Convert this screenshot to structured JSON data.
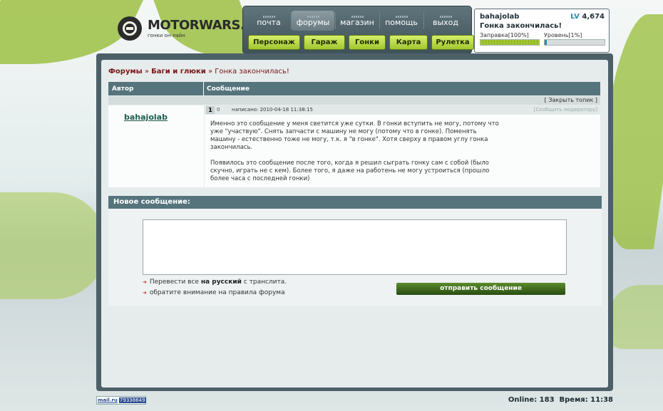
{
  "logo": {
    "title": "MOTORWARS.RU",
    "subtitle": "гонки он-лайн"
  },
  "nav": {
    "top": [
      "почта",
      "форумы",
      "магазин",
      "помощь",
      "выход"
    ],
    "active_tab": "форумы",
    "bottom": [
      "Персонаж",
      "Гараж",
      "Гонки",
      "Карта",
      "Рулетка"
    ]
  },
  "user": {
    "name": "bahajolab",
    "level_prefix": "LV",
    "level": "4,674",
    "status": "Гонка закончилась!",
    "fuel_label": "Заправка[100%]",
    "fuel_value": 1.0,
    "level_label": "Уровень[1%]",
    "level_progress": 0.01
  },
  "breadcrumb": {
    "forums": "Форумы",
    "sep1": " » ",
    "section": "Баги и глюки",
    "sep2": " » ",
    "topic": "Гонка закончилась!"
  },
  "table": {
    "col_author": "Автор",
    "col_message": "Сообщение",
    "close_topic": "[ Закрыть топик ]"
  },
  "post": {
    "author": "bahajolab",
    "page_current": "1",
    "page_other": "0",
    "posted": "написано: 2010-04-18 11:38:15",
    "report": "[Сообщить модератору]",
    "paragraph1": "Именно это сообщение у меня светится уже сутки. В гонки вступить не могу, потому что уже \"участвую\". Снять запчасти с машину не могу (потому что в гонке). Поменять машину - естественно тоже не могу, т.к. я \"в гонке\". Хотя сверху в правом углу гонка закончилась.",
    "paragraph2": "Появилось это сообщение после того, когда я решил сыграть гонку сам с собой (было скучно, играть не с кем). Более того, я даже на работень не могу устроиться (прошло более часа с последней гонки)"
  },
  "new_message": {
    "header": "Новое сообщение:",
    "hint1_prefix": "Перевести все ",
    "hint1_bold": "на русский",
    "hint1_suffix": " с транслита.",
    "hint2_prefix": "обратите внимание на ",
    "hint2_link": "правила форума",
    "send_button": "отправить сообщение"
  },
  "footer": {
    "counter_brand": "mail.ru",
    "counter_number": "79338649",
    "online": "Online: 183",
    "time": "Время: 11:38"
  },
  "colors": {
    "panel": "#4d6068",
    "header_bar": "#55747c",
    "accent_green": "#a3c530",
    "link_red": "#7a1414"
  }
}
